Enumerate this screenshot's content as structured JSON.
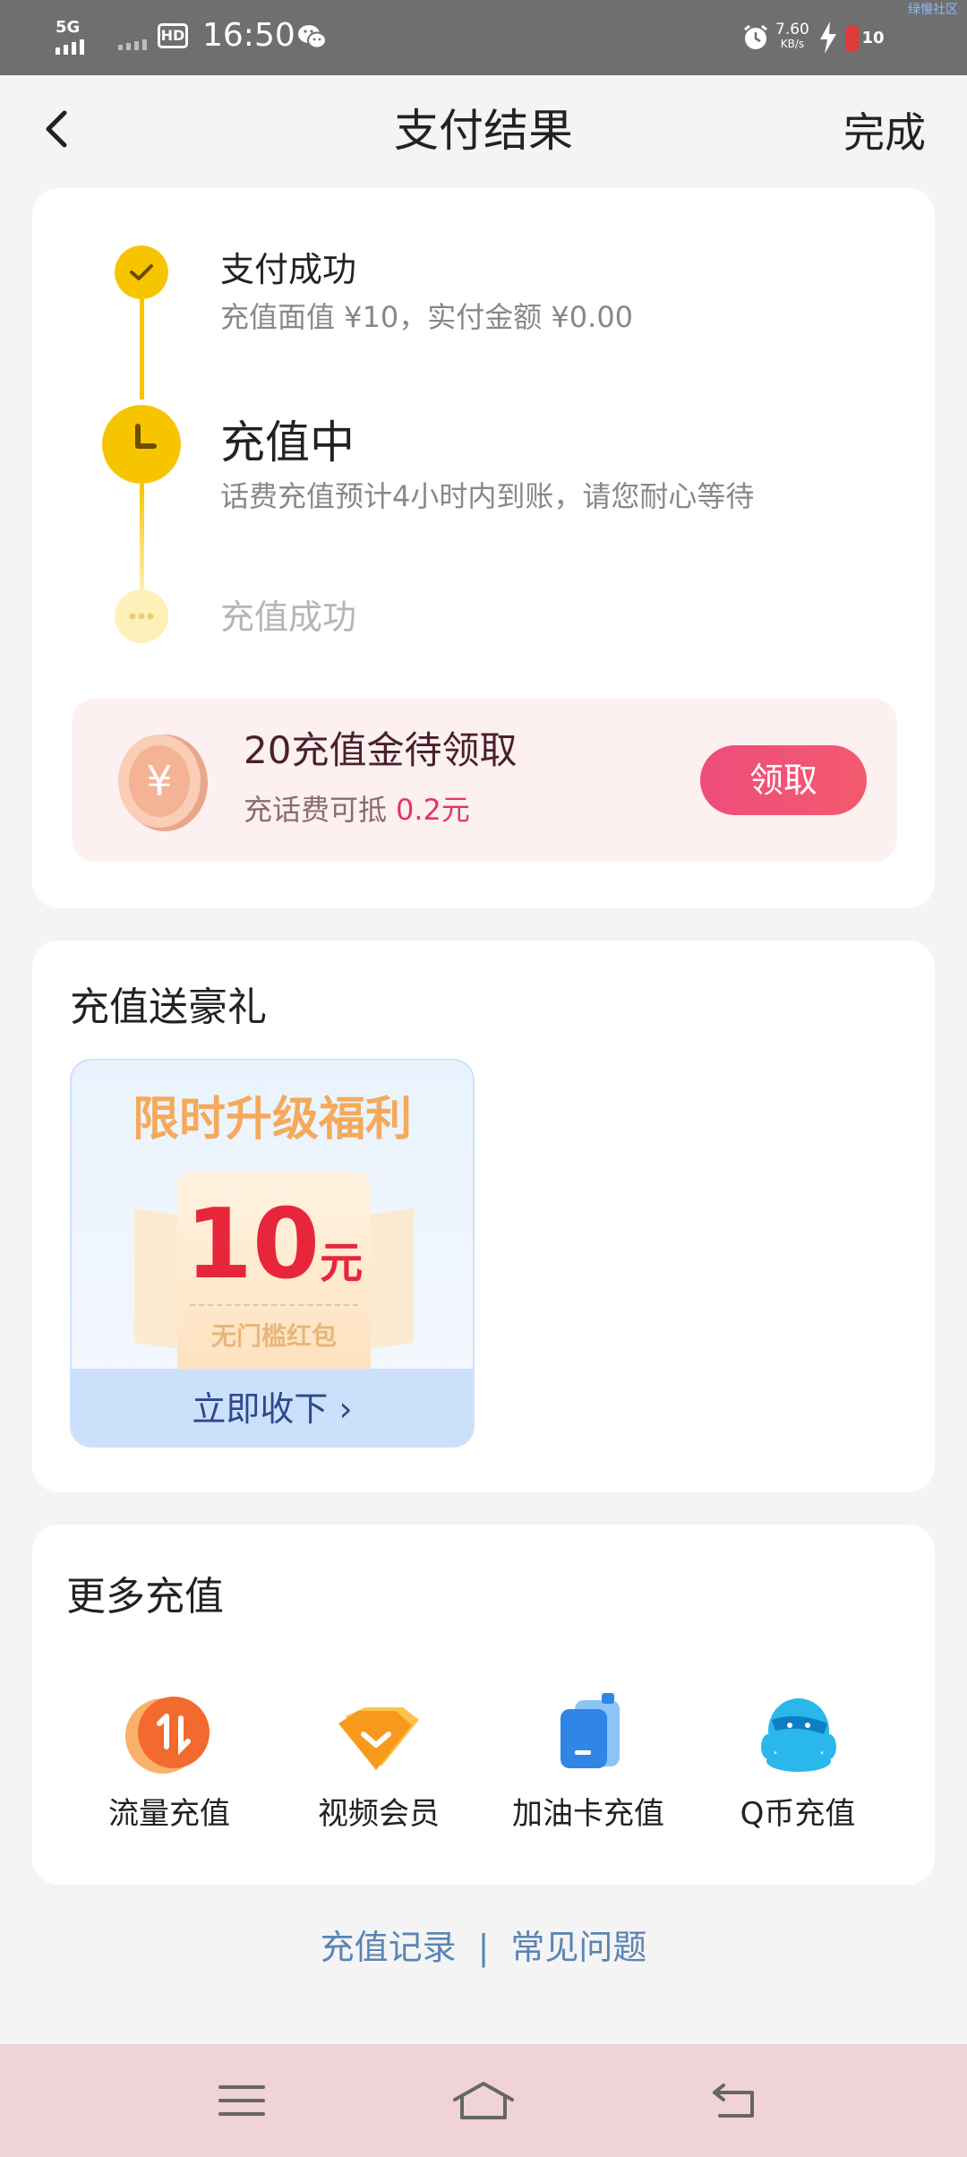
{
  "status_bar": {
    "network": "5G",
    "hd": "HD",
    "time": "16:50",
    "speed": "7.60",
    "speed_unit": "KB/s",
    "battery": "10",
    "corner_text": "绿慢社区"
  },
  "nav": {
    "title": "支付结果",
    "done": "完成"
  },
  "progress": {
    "step1_title": "支付成功",
    "step1_sub": "充值面值 ¥10，实付金额 ¥0.00",
    "step2_title": "充值中",
    "step2_sub": "话费充值预计4小时内到账，请您耐心等待",
    "step3_title": "充值成功",
    "accent": "#f7c500"
  },
  "reward": {
    "title": "20充值金待领取",
    "sub_prefix": "充话费可抵",
    "sub_amount": "0.2元",
    "button": "领取"
  },
  "gift": {
    "section_title": "充值送豪礼",
    "headline": "限时升级福利",
    "amount": "10",
    "unit": "元",
    "tag": "无门槛红包",
    "action": "立即收下 ›"
  },
  "more": {
    "section_title": "更多充值",
    "items": [
      {
        "label": "流量充值",
        "icon": "data-traffic-icon"
      },
      {
        "label": "视频会员",
        "icon": "video-member-icon"
      },
      {
        "label": "加油卡充值",
        "icon": "fuel-card-icon"
      },
      {
        "label": "Q币充值",
        "icon": "qq-coin-icon"
      }
    ]
  },
  "links": {
    "records": "充值记录",
    "separator": "|",
    "faq": "常见问题"
  }
}
